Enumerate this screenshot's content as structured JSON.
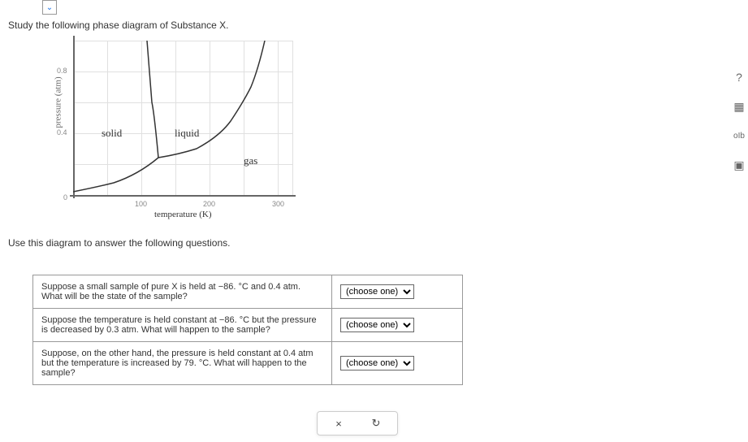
{
  "instruction_top": "Study the following phase diagram of Substance X.",
  "instruction_below": "Use this diagram to answer the following questions.",
  "axes": {
    "y_label": "pressure (atm)",
    "x_label": "temperature (K)",
    "y_ticks": [
      "0.8",
      "0.4",
      "0"
    ],
    "x_ticks": [
      "100",
      "200",
      "300"
    ]
  },
  "phases": {
    "solid": "solid",
    "liquid": "liquid",
    "gas": "gas"
  },
  "questions": [
    {
      "text_parts": [
        "Suppose a small sample of pure X is held at ",
        "−86. °C",
        " and ",
        "0.4 atm",
        ". What will be the state of the sample?"
      ],
      "placeholder": "(choose one)"
    },
    {
      "text_parts": [
        "Suppose the temperature is held constant at ",
        "−86. °C",
        " but the pressure is decreased by ",
        "0.3 atm",
        ". What will happen to the sample?"
      ],
      "placeholder": "(choose one)"
    },
    {
      "text_parts": [
        "Suppose, on the other hand, the pressure is held constant at ",
        "0.4 atm",
        " but the temperature is increased by ",
        "79. °C",
        ". What will happen to the sample?"
      ],
      "placeholder": "(choose one)"
    }
  ],
  "buttons": {
    "cancel": "×",
    "reset": "↻"
  },
  "side": {
    "help": "?",
    "tool1": "▦",
    "tool2": "oIb",
    "tool3": "▣"
  },
  "chart_data": {
    "type": "line",
    "title": "Phase diagram of Substance X",
    "xlabel": "temperature (K)",
    "ylabel": "pressure (atm)",
    "xlim": [
      0,
      320
    ],
    "ylim": [
      0,
      1.0
    ],
    "triple_point": {
      "T": 125,
      "P": 0.24
    },
    "series": [
      {
        "name": "solid-gas (sublimation)",
        "points": [
          {
            "T": 0,
            "P": 0.02
          },
          {
            "T": 60,
            "P": 0.08
          },
          {
            "T": 125,
            "P": 0.24
          }
        ]
      },
      {
        "name": "solid-liquid (fusion)",
        "points": [
          {
            "T": 125,
            "P": 0.24
          },
          {
            "T": 115,
            "P": 0.6
          },
          {
            "T": 108,
            "P": 1.0
          }
        ]
      },
      {
        "name": "liquid-gas (vaporization)",
        "points": [
          {
            "T": 125,
            "P": 0.24
          },
          {
            "T": 180,
            "P": 0.3
          },
          {
            "T": 230,
            "P": 0.48
          },
          {
            "T": 260,
            "P": 0.7
          },
          {
            "T": 280,
            "P": 1.0
          }
        ]
      }
    ],
    "region_labels": [
      {
        "name": "solid",
        "T": 60,
        "P": 0.4
      },
      {
        "name": "liquid",
        "T": 170,
        "P": 0.4
      },
      {
        "name": "gas",
        "T": 260,
        "P": 0.22
      }
    ]
  }
}
